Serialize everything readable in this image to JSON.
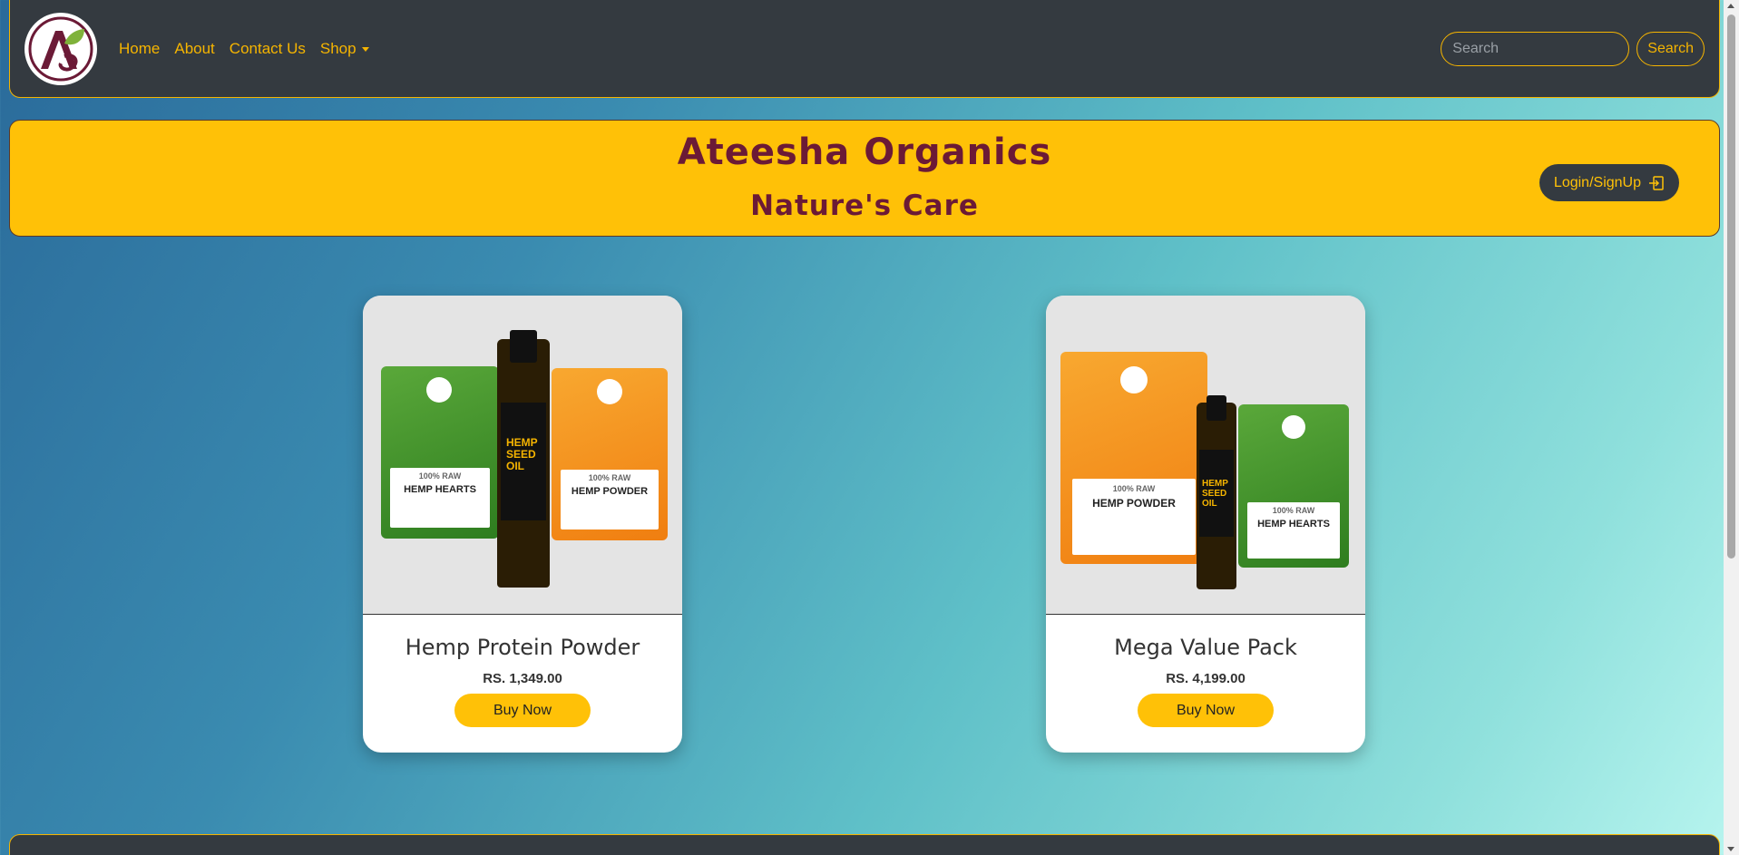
{
  "nav": {
    "logo_icon": "ateesha-logo-icon",
    "links": [
      {
        "label": "Home"
      },
      {
        "label": "About"
      },
      {
        "label": "Contact Us"
      },
      {
        "label": "Shop"
      }
    ],
    "search_placeholder": "Search",
    "search_button": "Search"
  },
  "banner": {
    "title": "Ateesha Organics",
    "subtitle": "Nature's Care",
    "login_label": "Login/SignUp",
    "login_icon": "login-arrow-icon"
  },
  "products": [
    {
      "name": "Hemp Protein Powder",
      "price": "RS. 1,349.00",
      "buy_label": "Buy Now"
    },
    {
      "name": "Mega Value Pack",
      "price": "RS. 4,199.00",
      "buy_label": "Buy Now"
    }
  ],
  "product_art": {
    "card1": {
      "left_pouch": "HEMP HEARTS",
      "right_pouch": "HEMP POWDER",
      "bottle": [
        "HEMP",
        "SEED",
        "OIL"
      ],
      "raw": "100% RAW"
    },
    "card2": {
      "left_pouch": "HEMP POWDER",
      "right_pouch": "HEMP HEARTS",
      "bottle": [
        "HEMP",
        "SEED",
        "OIL"
      ],
      "raw": "100% RAW"
    }
  },
  "colors": {
    "accent": "#ffc107",
    "nav_bg": "#343a40",
    "brand_text": "#6b1a36"
  }
}
